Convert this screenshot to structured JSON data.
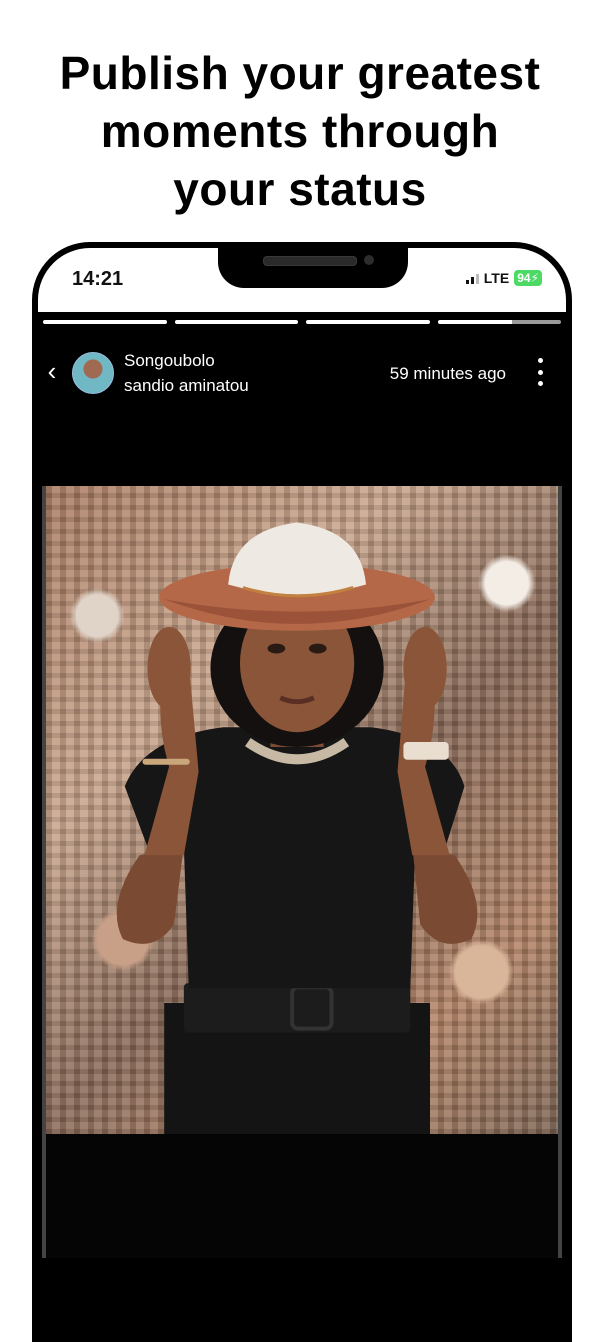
{
  "headline": {
    "line1": "Publish your greatest",
    "line2": "moments through",
    "line3": "your status"
  },
  "status_bar": {
    "time": "14:21",
    "network": "LTE",
    "battery": "94"
  },
  "story": {
    "segments_total": 4,
    "current_segment_progress": 0.6,
    "author_line1": "Songoubolo",
    "author_line2": "sandio aminatou",
    "posted_ago": "59 minutes ago",
    "back_icon": "chevron-left-icon",
    "menu_icon": "more-vertical-icon"
  },
  "colors": {
    "story_background": "#000000",
    "progress_active": "#ffffff",
    "battery": "#4cd964"
  }
}
